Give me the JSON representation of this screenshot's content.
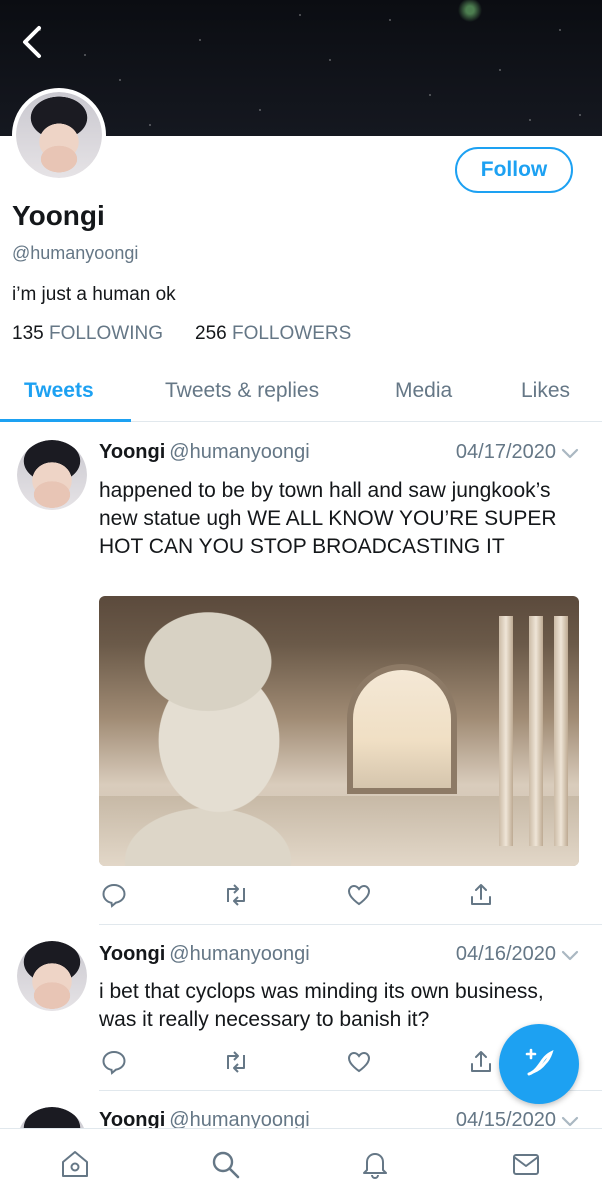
{
  "profile": {
    "name": "Yoongi",
    "handle": "@humanyoongi",
    "bio": "i’m just a human ok",
    "following_count": "135",
    "following_label": "FOLLOWING",
    "followers_count": "256",
    "followers_label": "FOLLOWERS",
    "follow_label": "Follow"
  },
  "tabs": [
    {
      "label": "Tweets",
      "active": true
    },
    {
      "label": "Tweets & replies",
      "active": false
    },
    {
      "label": "Media",
      "active": false
    },
    {
      "label": "Likes",
      "active": false
    }
  ],
  "tweets": [
    {
      "name": "Yoongi",
      "handle": "@humanyoongi",
      "date": "04/17/2020",
      "text": "happened to be by town hall and saw jungkook’s new statue ugh WE ALL KNOW YOU’RE SUPER HOT CAN YOU STOP BROADCASTING IT",
      "has_media": true
    },
    {
      "name": "Yoongi",
      "handle": "@humanyoongi",
      "date": "04/16/2020",
      "text": "i bet that cyclops was minding its own business, was it really necessary to banish it?",
      "has_media": false
    },
    {
      "name": "Yoongi",
      "handle": "@humanyoongi",
      "date": "04/15/2020",
      "text": "",
      "has_media": false
    }
  ],
  "icons": {
    "back": "back-arrow-icon",
    "reply": "reply-icon",
    "retweet": "retweet-icon",
    "like": "heart-icon",
    "share": "share-icon",
    "compose": "compose-tweet-icon",
    "home": "home-icon",
    "search": "search-icon",
    "notifications": "bell-icon",
    "messages": "mail-icon"
  },
  "colors": {
    "accent": "#1da1f2",
    "text": "#14171a",
    "muted": "#657786",
    "divider": "#e1e8ed"
  }
}
